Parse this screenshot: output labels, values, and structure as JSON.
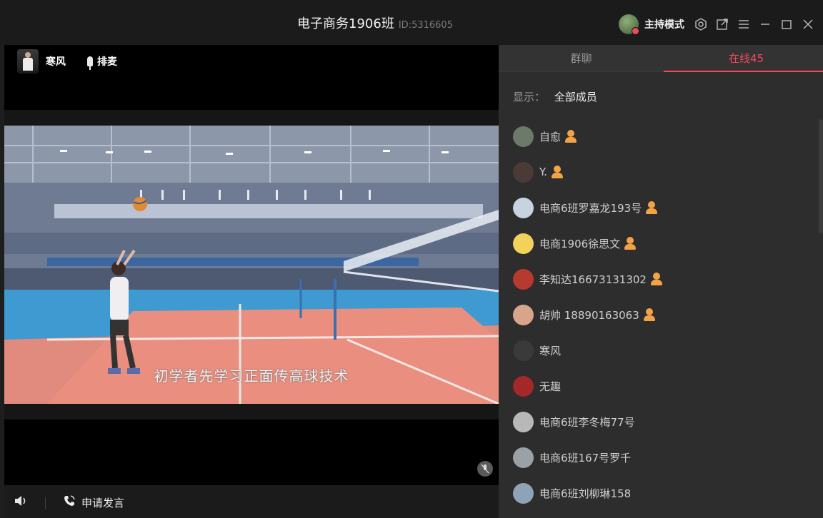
{
  "window": {
    "title": "电子商务1906班",
    "id_label": "ID:5316605",
    "host_mode_label": "主持模式",
    "icons": [
      "settings-icon",
      "popout-icon",
      "menu-icon",
      "minimize-icon",
      "maximize-icon",
      "close-icon"
    ]
  },
  "video": {
    "presenter_name": "寒风",
    "rank_label": "排麦",
    "subtitle": "初学者先学习正面传高球技术",
    "mic_state": "muted"
  },
  "bottom_bar": {
    "apply_label": "申请发言"
  },
  "panel": {
    "tabs": [
      {
        "label": "群聊",
        "active": false
      },
      {
        "label": "在线45",
        "active": true
      }
    ],
    "filter_label": "显示：",
    "filter_value": "全部成员",
    "members": [
      {
        "name": "自愈",
        "badge": true,
        "avatar_color": "#6c7a6a"
      },
      {
        "name": "Y.",
        "badge": true,
        "avatar_color": "#4a3b36"
      },
      {
        "name": "电商6班罗嘉龙193号",
        "badge": true,
        "avatar_color": "#c7d3de"
      },
      {
        "name": "电商1906徐思文",
        "badge": true,
        "avatar_color": "#f3d15a"
      },
      {
        "name": "李知达16673131302",
        "badge": true,
        "avatar_color": "#b73a2f"
      },
      {
        "name": "胡帅 18890163063",
        "badge": true,
        "avatar_color": "#d9a58a"
      },
      {
        "name": "寒风",
        "badge": false,
        "avatar_color": "#3a3a3a"
      },
      {
        "name": "无趣",
        "badge": false,
        "avatar_color": "#a4272a"
      },
      {
        "name": "电商6班李冬梅77号",
        "badge": false,
        "avatar_color": "#b8b8b8"
      },
      {
        "name": "电商6班167号罗千",
        "badge": false,
        "avatar_color": "#9aa1a7"
      },
      {
        "name": "电商6班刘柳琳158",
        "badge": false,
        "avatar_color": "#8fa3b8"
      }
    ],
    "accent_color": "#ee4c5c"
  }
}
